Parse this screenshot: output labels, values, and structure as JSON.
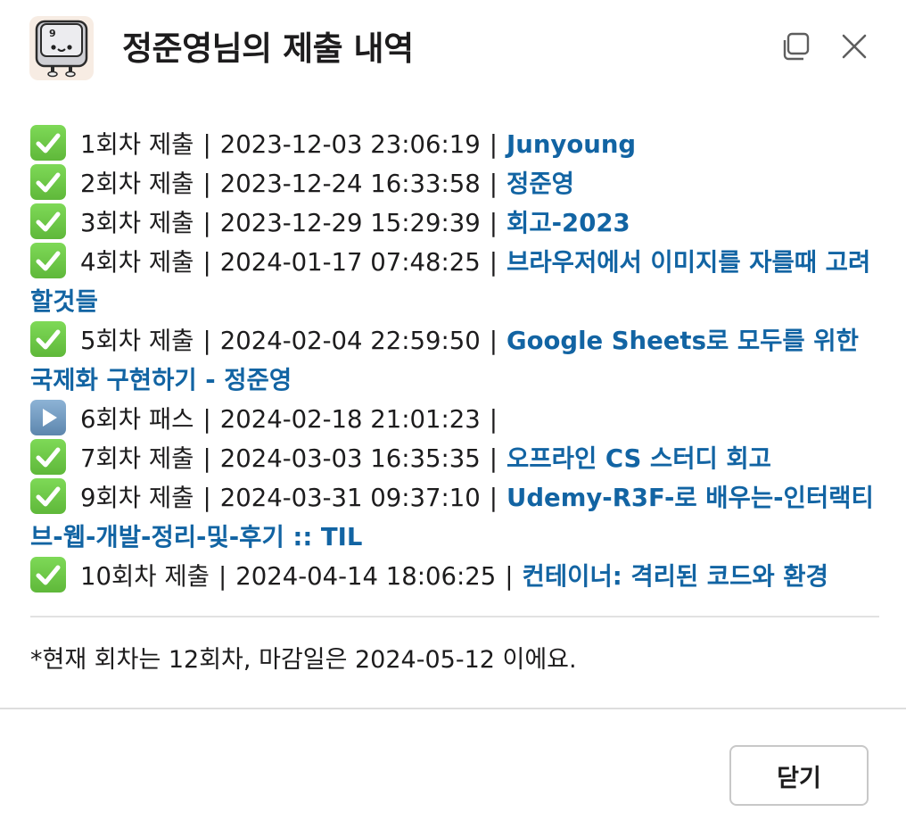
{
  "header": {
    "title": "정준영님의 제출 내역",
    "logo_icon": "keyboard-key-mascot-icon",
    "copy_icon": "copy-icon",
    "close_icon": "close-icon"
  },
  "entries": [
    {
      "status": "check",
      "round": "1회차 제출",
      "datetime": "2023-12-03 23:06:19",
      "link": "Junyoung"
    },
    {
      "status": "check",
      "round": "2회차 제출",
      "datetime": "2023-12-24 16:33:58",
      "link": "정준영"
    },
    {
      "status": "check",
      "round": "3회차 제출",
      "datetime": "2023-12-29 15:29:39",
      "link": "회고-2023"
    },
    {
      "status": "check",
      "round": "4회차 제출",
      "datetime": "2024-01-17 07:48:25",
      "link": "브라우저에서 이미지를 자를때 고려할것들"
    },
    {
      "status": "check",
      "round": "5회차 제출",
      "datetime": "2024-02-04 22:59:50",
      "link": "Google Sheets로 모두를 위한 국제화 구현하기 - 정준영"
    },
    {
      "status": "pass",
      "round": "6회차 패스",
      "datetime": "2024-02-18 21:01:23",
      "link": ""
    },
    {
      "status": "check",
      "round": "7회차 제출",
      "datetime": "2024-03-03 16:35:35",
      "link": "오프라인 CS 스터디 회고"
    },
    {
      "status": "check",
      "round": "9회차 제출",
      "datetime": "2024-03-31 09:37:10",
      "link": "Udemy-R3F-로 배우는-인터랙티브-웹-개발-정리-및-후기 :: TIL"
    },
    {
      "status": "check",
      "round": "10회차 제출",
      "datetime": "2024-04-14 18:06:25",
      "link": "컨테이너: 격리된 코드와 환경"
    }
  ],
  "separator": "|",
  "note": "*현재 회차는 12회차, 마감일은 2024-05-12 이에요.",
  "footer": {
    "close_label": "닫기"
  },
  "colors": {
    "link": "#1264a3",
    "check_bg": "#6cc644",
    "pass_bg": "#6f97bd"
  }
}
